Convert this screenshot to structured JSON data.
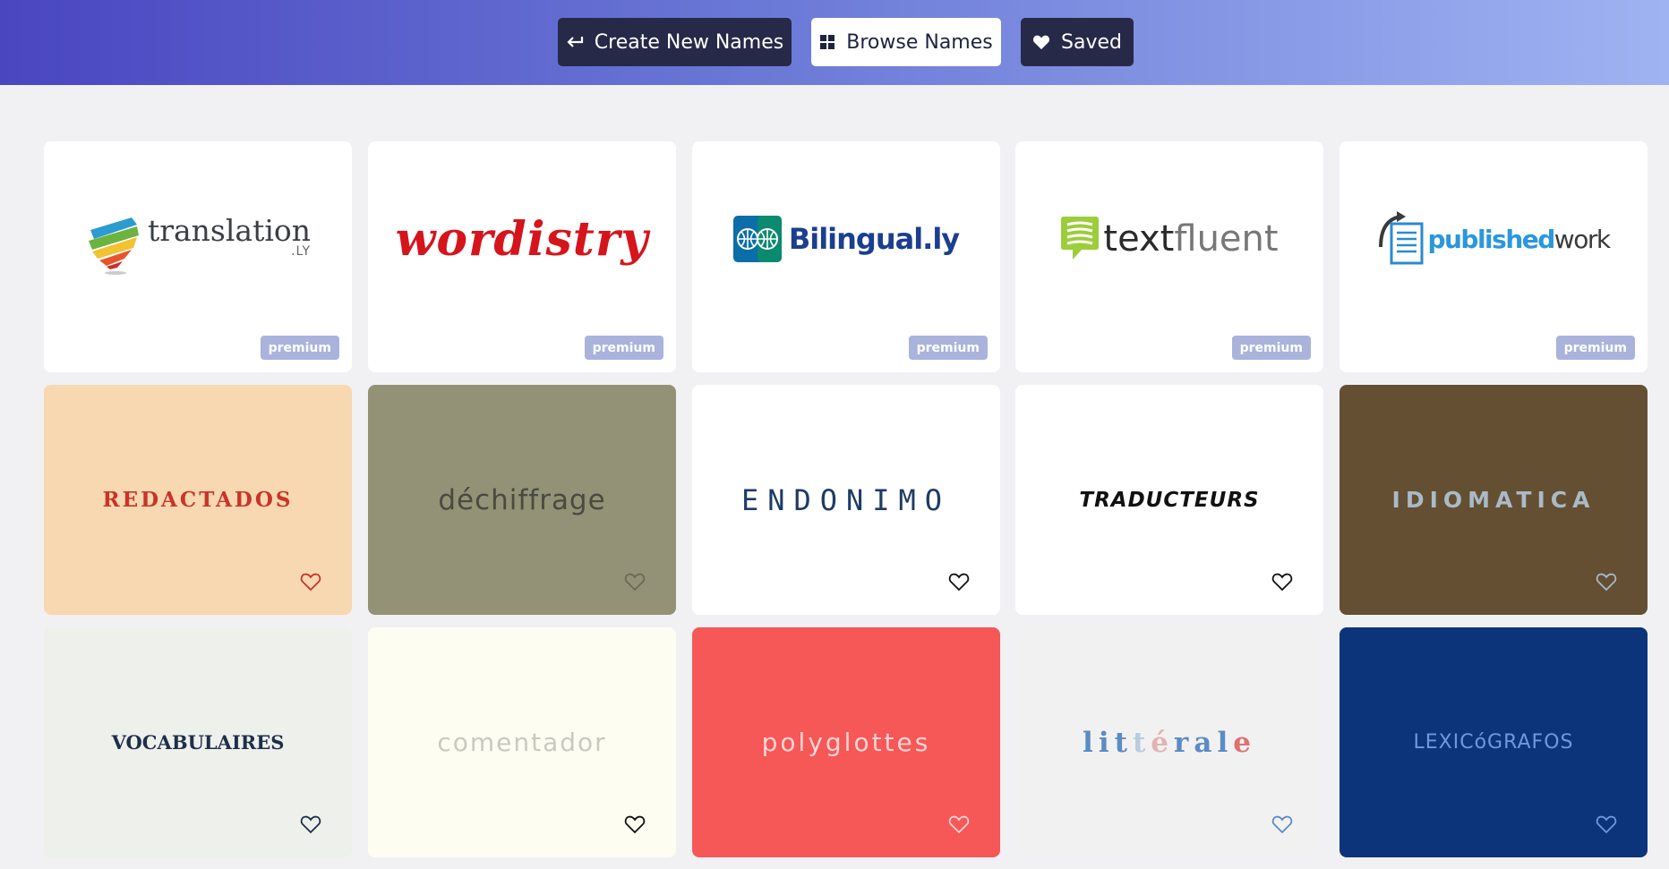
{
  "nav": {
    "create_label": "Create New Names",
    "browse_label": "Browse Names",
    "saved_label": "Saved"
  },
  "premium_cards": [
    {
      "name_main": "translation",
      "name_suffix": ".LY",
      "badge": "premium"
    },
    {
      "name": "wordistry",
      "badge": "premium"
    },
    {
      "name": "Bilingual.ly",
      "badge": "premium"
    },
    {
      "name_part1": "text",
      "name_part2": "fluent",
      "badge": "premium"
    },
    {
      "name_part1": "published",
      "name_part2": "work",
      "badge": "premium"
    }
  ],
  "name_cards": [
    {
      "name": "REDACTADOS",
      "bg": "#f7d8b0",
      "color": "#c8342a"
    },
    {
      "name": "déchiffrage",
      "bg": "#939276",
      "color": "#4a4a40"
    },
    {
      "name": "ENDONIMO",
      "bg": "#ffffff",
      "color": "#1d3c63"
    },
    {
      "name": "TRADUCTEURS",
      "bg": "#ffffff",
      "color": "#111111"
    },
    {
      "name": "IDIOMATICA",
      "bg": "#644f32",
      "color": "#a9bac8"
    },
    {
      "name": "VOCABULAIRES",
      "bg": "#eef0ec",
      "color": "#1f2f4a"
    },
    {
      "name": "comentador",
      "bg": "#fdfdf2",
      "color": "#c9c9c0"
    },
    {
      "name": "polyglottes",
      "bg": "#f65757",
      "color": "#ffd4d4"
    },
    {
      "name": "littérale",
      "bg": "#f2f1f1",
      "color": "#5a8cc4"
    },
    {
      "name": "LEXICóGRAFOS",
      "bg": "#0c347a",
      "color": "#6f98e0"
    }
  ],
  "icons": {
    "create": "return-arrow-icon",
    "browse": "grid-icon",
    "saved": "heart-icon",
    "card_save": "heart-outline-icon"
  }
}
